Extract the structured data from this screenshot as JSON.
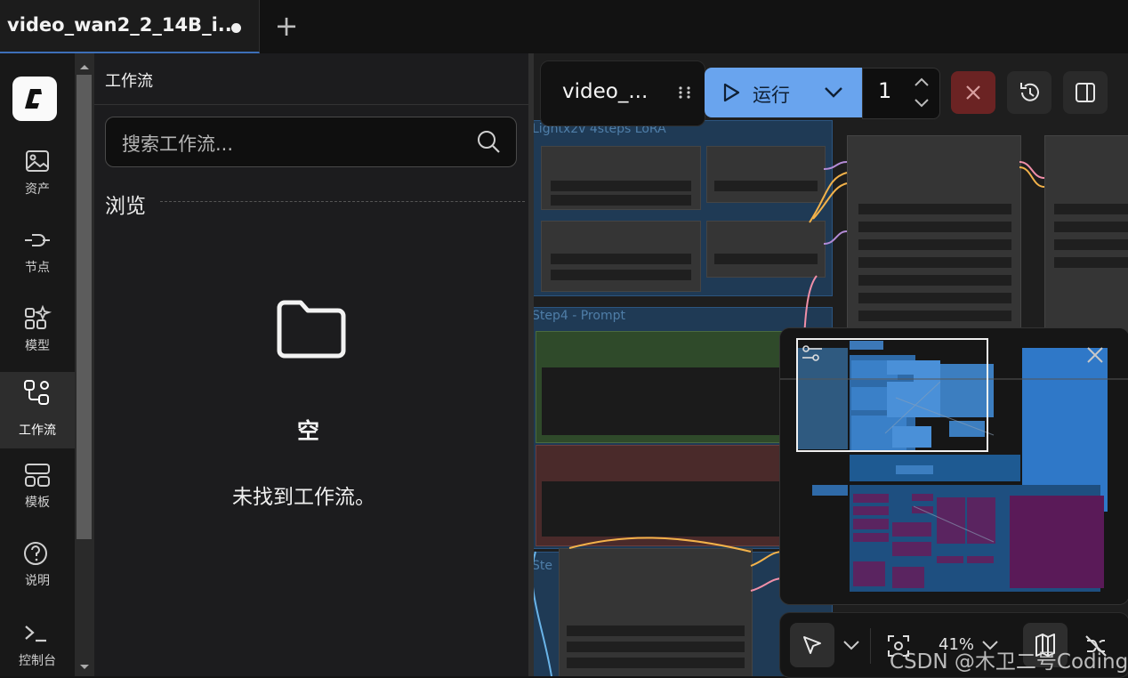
{
  "tabs": [
    {
      "title": "video_wan2_2_14B_i...",
      "unsaved": true
    }
  ],
  "new_tab_label": "+",
  "sidebar": {
    "items": [
      {
        "label": "资产",
        "icon": "image-icon"
      },
      {
        "label": "节点",
        "icon": "node-icon"
      },
      {
        "label": "模型",
        "icon": "model-icon"
      },
      {
        "label": "工作流",
        "icon": "workflow-icon",
        "active": true
      },
      {
        "label": "模板",
        "icon": "template-icon"
      },
      {
        "label": "说明",
        "icon": "help-icon"
      },
      {
        "label": "控制台",
        "icon": "terminal-icon"
      }
    ]
  },
  "panel": {
    "title": "工作流",
    "search_placeholder": "搜索工作流...",
    "browse_label": "浏览",
    "empty_title": "空",
    "empty_message": "未找到工作流。"
  },
  "canvas": {
    "groups": [
      "Lightx2v 4steps LoRA",
      "Step4 - Prompt",
      "Ste"
    ]
  },
  "toolbar": {
    "workflow_name": "video_...",
    "run_label": "运行",
    "run_count": "1"
  },
  "bottom": {
    "zoom": "41%"
  },
  "watermark": "CSDN @木卫二号Coding",
  "colors": {
    "accent": "#69a4ee",
    "stop": "#6b2323",
    "group": "#1f3a55",
    "prompt_positive": "#2f4a2a",
    "prompt_negative": "#4a2a2a"
  }
}
